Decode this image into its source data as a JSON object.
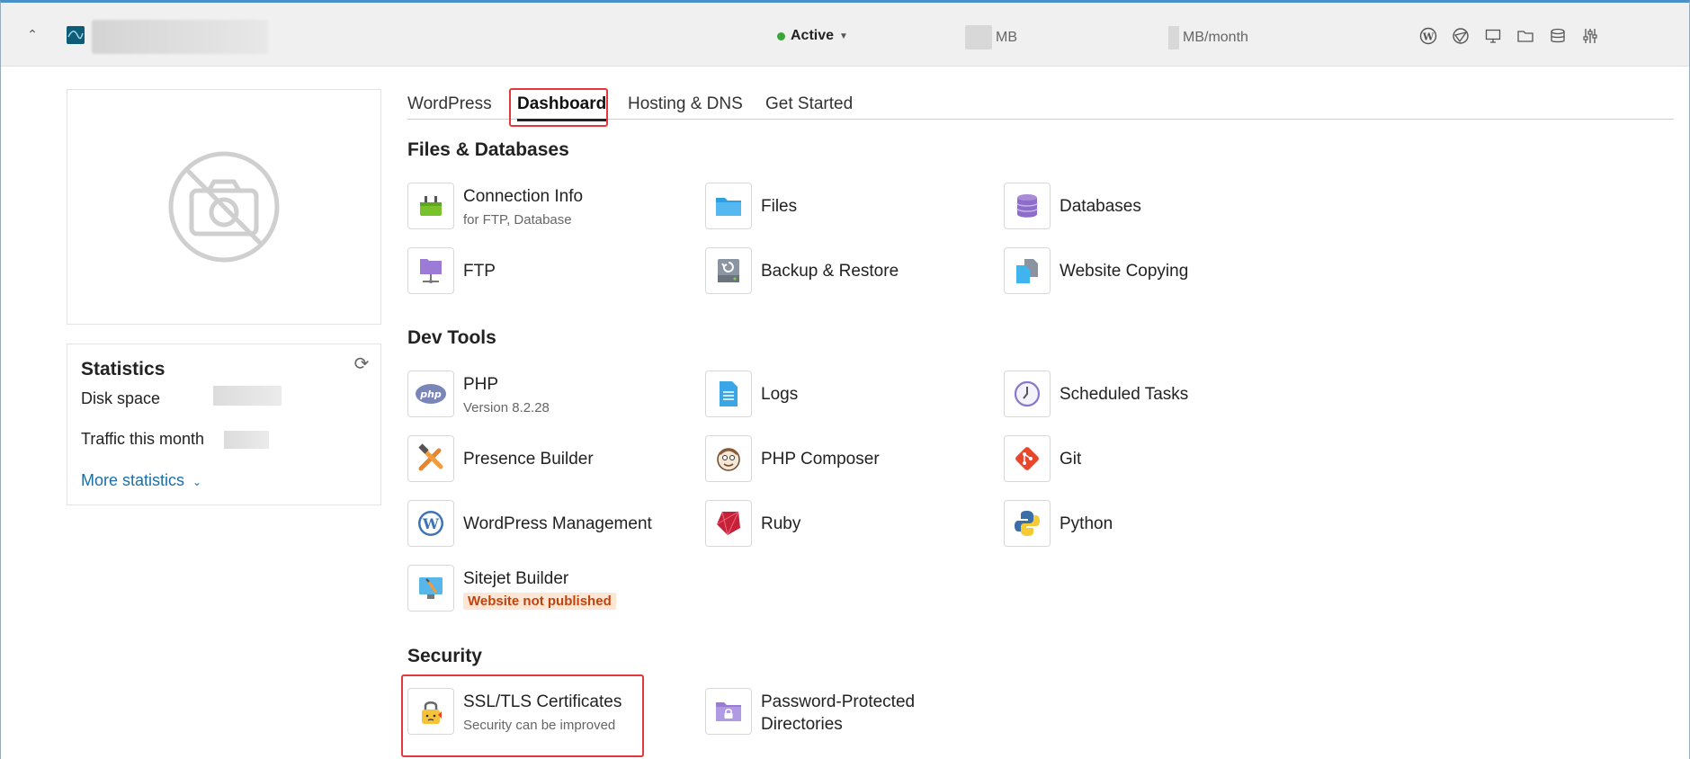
{
  "header": {
    "status_label": "Active",
    "disk_unit": "MB",
    "traffic_unit": "MB/month",
    "icons": [
      "wordpress-icon",
      "sitejet-icon",
      "monitor-icon",
      "folder-icon",
      "database-icon",
      "sliders-icon"
    ]
  },
  "statistics": {
    "title": "Statistics",
    "disk_space_label": "Disk space",
    "traffic_label": "Traffic this month",
    "more_label": "More statistics"
  },
  "tabs": [
    {
      "label": "WordPress"
    },
    {
      "label": "Dashboard"
    },
    {
      "label": "Hosting & DNS"
    },
    {
      "label": "Get Started"
    }
  ],
  "sections": {
    "files": "Files & Databases",
    "dev": "Dev Tools",
    "security": "Security"
  },
  "tiles": {
    "connection_info": {
      "label": "Connection Info",
      "sub": "for FTP, Database"
    },
    "files": {
      "label": "Files"
    },
    "databases": {
      "label": "Databases"
    },
    "ftp": {
      "label": "FTP"
    },
    "backup": {
      "label": "Backup & Restore"
    },
    "website_copying": {
      "label": "Website Copying"
    },
    "php": {
      "label": "PHP",
      "sub": "Version 8.2.28"
    },
    "logs": {
      "label": "Logs"
    },
    "scheduled_tasks": {
      "label": "Scheduled Tasks"
    },
    "presence_builder": {
      "label": "Presence Builder"
    },
    "php_composer": {
      "label": "PHP Composer"
    },
    "git": {
      "label": "Git"
    },
    "wordpress_mgmt": {
      "label": "WordPress Management"
    },
    "ruby": {
      "label": "Ruby"
    },
    "python": {
      "label": "Python"
    },
    "sitejet": {
      "label": "Sitejet Builder",
      "badge": "Website not published"
    },
    "ssl": {
      "label": "SSL/TLS Certificates",
      "sub": "Security can be improved"
    },
    "password_dirs": {
      "label_line1": "Password-Protected",
      "label_line2": "Directories"
    }
  }
}
